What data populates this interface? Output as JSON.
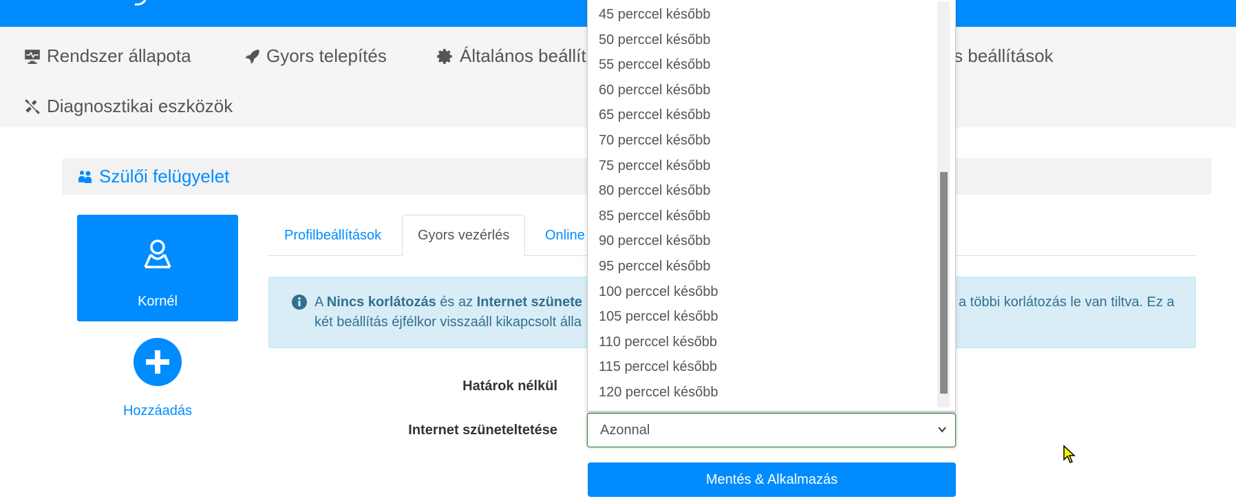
{
  "nav": {
    "items": [
      {
        "label": "Rendszer állapota",
        "icon": "monitor-icon"
      },
      {
        "label": "Gyors telepítés",
        "icon": "rocket-icon"
      },
      {
        "label": "Általános beállít",
        "icon": "gear-icon"
      },
      {
        "label": "ális beállítások",
        "icon": ""
      },
      {
        "label": "Diagnosztikai eszközök",
        "icon": "tools-icon"
      }
    ]
  },
  "panel": {
    "title": "Szülői felügyelet"
  },
  "profile": {
    "name": "Kornél",
    "add_label": "Hozzáadás"
  },
  "tabs": [
    {
      "label": "Profilbeállítások",
      "active": false
    },
    {
      "label": "Gyors vezérlés",
      "active": true
    },
    {
      "label": "Online",
      "active": false
    }
  ],
  "info": {
    "line1_a": "A ",
    "line1_b": "Nincs korlátozás",
    "line1_c": " és az ",
    "line1_d": "Internet szünete",
    "line1_e": "a többi korlátozás le van tiltva. Ez a",
    "line2_a": "két beállítás éjfélkor visszaáll kikapcsolt álla"
  },
  "form": {
    "label_no_limits": "Határok nélkül",
    "label_pause": "Internet szüneteltetése",
    "pause_value": "Azonnal",
    "save_label": "Mentés & Alkalmazás"
  },
  "dropdown": {
    "options": [
      "45 perccel később",
      "50 perccel később",
      "55 perccel később",
      "60 perccel később",
      "65 perccel később",
      "70 perccel később",
      "75 perccel később",
      "80 perccel később",
      "85 perccel később",
      "90 perccel később",
      "95 perccel később",
      "100 perccel később",
      "105 perccel később",
      "110 perccel később",
      "115 perccel később",
      "120 perccel később"
    ]
  },
  "colors": {
    "accent": "#008cff",
    "info_bg": "#d9edf7",
    "info_text": "#31708f",
    "valid": "#3c763d"
  }
}
